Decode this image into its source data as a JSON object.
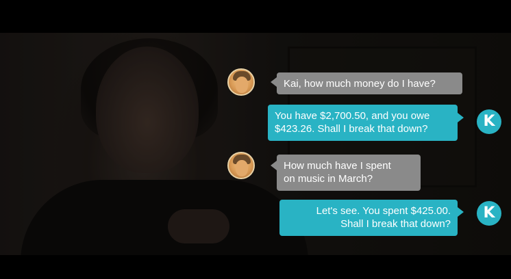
{
  "conversation": {
    "messages": [
      {
        "sender": "user",
        "lines": [
          "Kai, how much money do I have?"
        ]
      },
      {
        "sender": "kai",
        "lines": [
          "You have $2,700.50, and you owe",
          "$423.26. Shall I break that down?"
        ]
      },
      {
        "sender": "user",
        "lines": [
          "How much have I spent",
          "on music in March?"
        ]
      },
      {
        "sender": "kai",
        "lines": [
          "Let's see. You spent $425.00.",
          "Shall I break that down?"
        ]
      }
    ]
  },
  "kai_avatar": {
    "letter": "K",
    "icon": "kai-logo-icon"
  },
  "user_avatar": {
    "icon": "user-avatar-icon"
  },
  "colors": {
    "user_bubble": "#8a8a8a",
    "kai_bubble": "#29b3c4",
    "text": "#ffffff"
  }
}
